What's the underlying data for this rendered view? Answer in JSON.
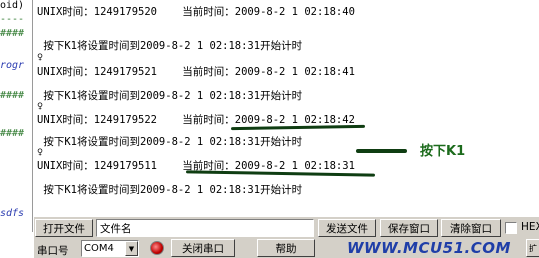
{
  "code_strip": {
    "lines": [
      "oid)",
      "----",
      "####",
      "rogr",
      "####",
      "####",
      "sdfs"
    ]
  },
  "terminal": {
    "lines": [
      "UNIX时间：1249179520    当前时间：2009-8-2 1 02:18:40",
      " 按下K1将设置时间到2009-8-2 1 02:18:31开始计时",
      "♀",
      "UNIX时间：1249179521    当前时间：2009-8-2 1 02:18:41",
      " 按下K1将设置时间到2009-8-2 1 02:18:31开始计时",
      "♀",
      "UNIX时间：1249179522    当前时间：2009-8-2 1 02:18:42",
      " 按下K1将设置时间到2009-8-2 1 02:18:31开始计时",
      "♀",
      "UNIX时间：1249179511    当前时间：2009-8-2 1 02:18:31",
      " 按下K1将设置时间到2009-8-2 1 02:18:31开始计时"
    ],
    "annotation": "按下K1"
  },
  "toolbar": {
    "open_file": "打开文件",
    "filename": "文件名",
    "send_file": "发送文件",
    "save_window": "保存窗口",
    "clear_window": "清除窗口",
    "hex_label": "HEX",
    "port_label": "串口号",
    "port_value": "COM4",
    "close_port": "关闭串口",
    "help": "帮助",
    "website": "WWW.MCU51.COM",
    "scroll_label": "扩"
  },
  "colors": {
    "toolbar_bg": "#d4d0c8",
    "annotation": "#1c6b1c",
    "marker": "#0f3d12",
    "website": "#1f3ea8",
    "led": "#c00000"
  }
}
